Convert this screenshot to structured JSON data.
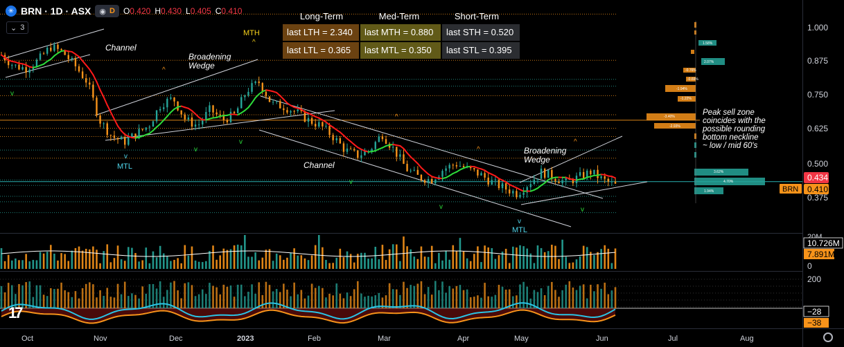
{
  "header": {
    "symbol": "BRN · 1D · ASX",
    "eye_icon": "eye-icon",
    "d_badge": "D",
    "open_label": "O",
    "open": "0.420",
    "high_label": "H",
    "high": "0.430",
    "low_label": "L",
    "low": "0.405",
    "close_label": "C",
    "close": "0.410",
    "layers_count": "3"
  },
  "summary_table": {
    "headers": [
      "Long-Term",
      "Med-Term",
      "Short-Term"
    ],
    "row1": [
      "last LTH = 2.340",
      "last MTH = 0.880",
      "last STH = 0.520"
    ],
    "row2": [
      "last LTL = 0.365",
      "last MTL = 0.350",
      "last STL = 0.395"
    ]
  },
  "annotations": {
    "channel_1": "Channel",
    "broadening_1": "Broadening\nWedge",
    "mth": "MTH",
    "mtl_1": "MTL",
    "channel_2": "Channel",
    "broadening_2": "Broadening\nWedge",
    "mtl_2": "MTL",
    "note": "Peak sell zone\ncoincides with the\npossible rounding\nbottom neckline\n~ low / mid 60's"
  },
  "price_axis": {
    "ticks": [
      "1.000",
      "0.875",
      "0.750",
      "0.625",
      "0.500",
      "0.375"
    ],
    "current_price": "0.434",
    "symbol_tag": "BRN",
    "last_price": "0.410"
  },
  "volume_axis": {
    "top_tick": "20M",
    "value_1": "10.726M",
    "value_2": "7.891M",
    "bottom_tick": "0"
  },
  "oscillator_axis": {
    "top_tick": "200",
    "value_1": "−28",
    "value_2": "−38"
  },
  "time_axis": [
    "Oct",
    "Nov",
    "Dec",
    "2023",
    "Feb",
    "Mar",
    "Apr",
    "May",
    "Jun",
    "Jul",
    "Aug"
  ],
  "volume_profile_labels": [
    "1.58%",
    "2.07%",
    "-0.76%",
    "-0.69%",
    "-1.94%",
    "-1.22%",
    "-3.40%",
    "-2.93%",
    "3.62%",
    "4.70%",
    "1.94%"
  ],
  "colors": {
    "bull": "#26a69a",
    "bear": "#f7931a",
    "ma_down": "#ff1a1a",
    "ma_up": "#2ddb3a",
    "price_line": "#2bb3b3",
    "current_tag": "#f23645",
    "last_tag": "#f7931a"
  },
  "chart_data": {
    "type": "candlestick",
    "title": "BRN · 1D · ASX",
    "ylim": [
      0.3,
      1.06
    ],
    "x_labels": [
      "Oct",
      "Nov",
      "Dec",
      "2023",
      "Feb",
      "Mar",
      "Apr",
      "May",
      "Jun"
    ],
    "close_path": [
      0.9,
      0.86,
      0.85,
      0.88,
      0.93,
      0.91,
      0.86,
      0.8,
      0.66,
      0.6,
      0.58,
      0.61,
      0.64,
      0.72,
      0.74,
      0.66,
      0.64,
      0.7,
      0.66,
      0.68,
      0.77,
      0.8,
      0.72,
      0.71,
      0.69,
      0.66,
      0.64,
      0.6,
      0.55,
      0.53,
      0.55,
      0.61,
      0.55,
      0.48,
      0.45,
      0.44,
      0.48,
      0.5,
      0.48,
      0.46,
      0.43,
      0.41,
      0.39,
      0.43,
      0.47,
      0.45,
      0.43,
      0.45,
      0.47,
      0.44,
      0.42
    ],
    "horizontal_levels": [
      1.05,
      0.88,
      0.81,
      0.785,
      0.75,
      0.68,
      0.63,
      0.6,
      0.55,
      0.52,
      0.44,
      0.42,
      0.38,
      0.36,
      0.32
    ],
    "current_price": 0.434,
    "last_close": 0.41
  }
}
